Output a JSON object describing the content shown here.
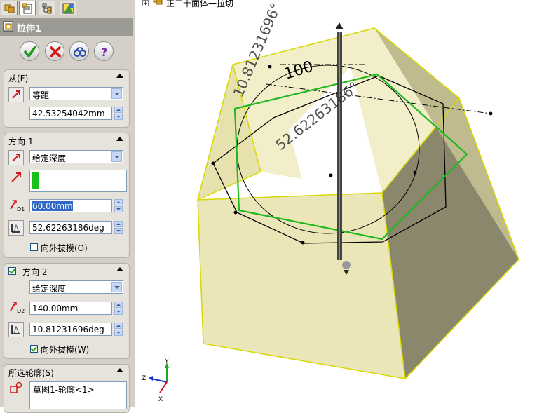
{
  "tabs": [
    {
      "icon": "feature-manager-icon"
    },
    {
      "icon": "property-manager-icon"
    },
    {
      "icon": "configuration-manager-icon"
    },
    {
      "icon": "display-manager-icon"
    }
  ],
  "feature": {
    "title": "拉伸1",
    "icon": "extrude-cut-icon"
  },
  "actions": [
    "ok-icon",
    "cancel-icon",
    "preview-icon",
    "help-icon"
  ],
  "from": {
    "header": "从(F)",
    "condition": "等距",
    "offset": "42.53254042mm"
  },
  "direction1": {
    "header": "方向 1",
    "end_condition": "给定深度",
    "depth": "60.00mm",
    "draft_angle": "52.62263186deg",
    "draft_outward_label": "向外拔模(O)",
    "draft_outward_checked": false
  },
  "direction2": {
    "header": "方向 2",
    "enabled": true,
    "end_condition": "给定深度",
    "depth": "140.00mm",
    "draft_angle": "10.81231696deg",
    "draft_outward_label": "向外拔模(W)",
    "draft_outward_checked": true
  },
  "contours": {
    "header": "所选轮廓(S)",
    "items": [
      "草图1-轮廓<1>"
    ]
  },
  "tree": {
    "item_label": "正二十面体一拉切"
  },
  "viewport": {
    "dim_labels": [
      "10.81231696°",
      "100",
      "52.62263186°"
    ],
    "triad": {
      "x": "X",
      "y": "Y",
      "z": "Z"
    },
    "colors": {
      "body": "#ebe6b4",
      "edge_highlight": "#ffff00",
      "sketch": "#1fb81f"
    }
  }
}
